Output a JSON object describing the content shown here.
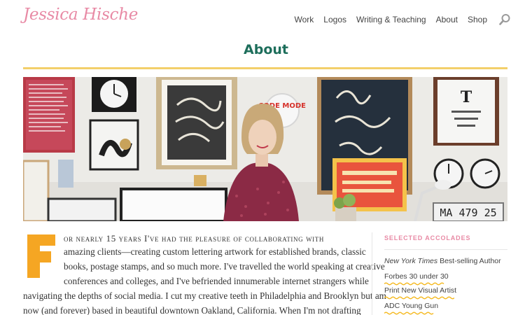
{
  "header": {
    "logo_text": "Jessica Hische",
    "nav": [
      "Work",
      "Logos",
      "Writing & Teaching",
      "About",
      "Shop"
    ],
    "search_icon": "search-icon"
  },
  "page": {
    "title": "About"
  },
  "hero": {
    "wall_text_you": "You",
    "wall_text_left": "left Me",
    "wall_text_in": "in",
    "wall_text_dark": "the Dark",
    "wall_text_code": "CODE MODE",
    "wall_text_plate": "MA 479 25",
    "wall_text_t": "T"
  },
  "article": {
    "dropcap": "F",
    "line1_smallcaps": "or nearly 15 years I've had the pleasure of collaborating with",
    "line2": "amazing clients—creating custom lettering artwork for established brands, classic",
    "line3": "books, postage stamps, and so much more. I've travelled the world speaking at creative",
    "line4": "conferences and colleges, and I've befriended innumerable internet strangers while",
    "line5": "navigating the depths of social media. I cut my creative teeth in Philadelphia and Brooklyn but am",
    "line6": "now (and forever) based in beautiful downtown Oakland, California. When I'm not drafting"
  },
  "sidebar": {
    "heading": "SELECTED ACCOLADES",
    "accolade1_italic": "New York Times",
    "accolade1_rest": " Best-selling Author",
    "accolade2": "Forbes 30 under 30",
    "accolade3": "Print New Visual Artist",
    "accolade4": "ADC Young Gun"
  },
  "colors": {
    "logo": "#e88aa5",
    "title": "#1d6e5b",
    "rule": "#f3cf6a",
    "dropcap": "#f5a623",
    "squiggle": "#f5b920"
  }
}
